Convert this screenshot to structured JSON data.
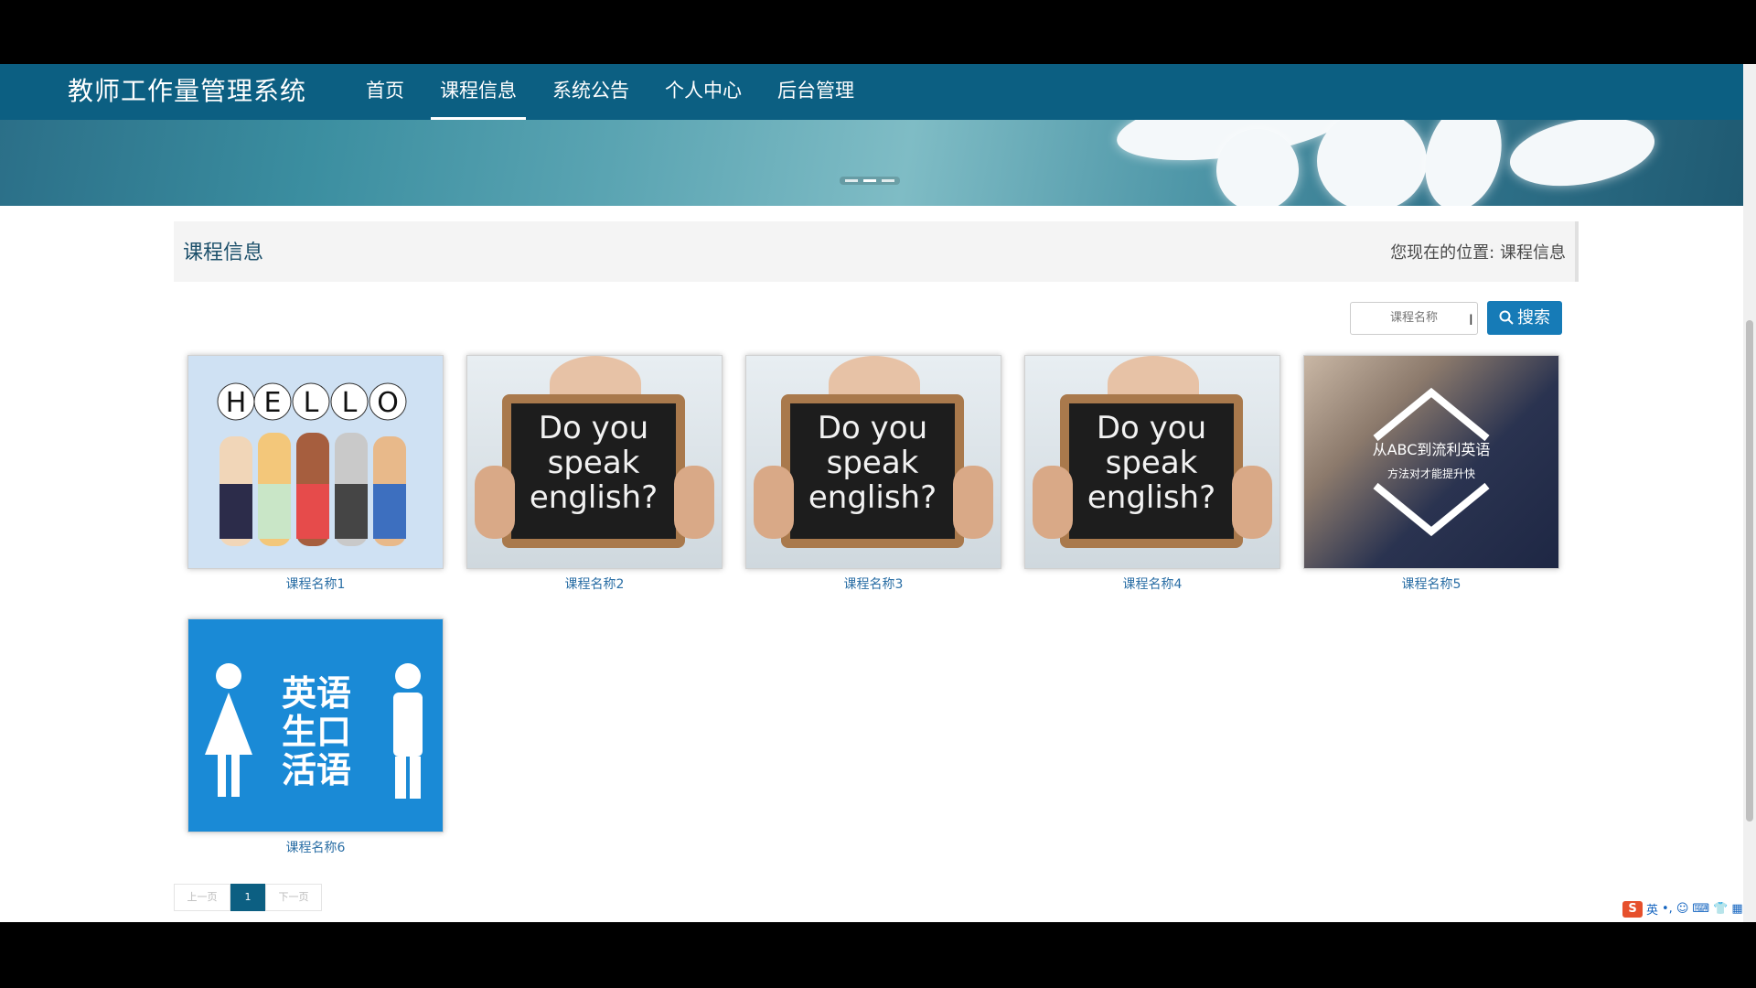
{
  "header": {
    "brand": "教师工作量管理系统",
    "nav": [
      {
        "label": "首页",
        "active": false
      },
      {
        "label": "课程信息",
        "active": true
      },
      {
        "label": "系统公告",
        "active": false
      },
      {
        "label": "个人中心",
        "active": false
      },
      {
        "label": "后台管理",
        "active": false
      }
    ]
  },
  "banner": {
    "slide_count": 3,
    "active_slide": 2
  },
  "page": {
    "title": "课程信息",
    "location_prefix": "您现在的位置:",
    "location_current": "课程信息"
  },
  "search": {
    "placeholder": "课程名称",
    "button_label": "搜索"
  },
  "courses": [
    {
      "name": "课程名称1",
      "image": "hello-cartoon"
    },
    {
      "name": "课程名称2",
      "image": "do-you-speak-english"
    },
    {
      "name": "课程名称3",
      "image": "do-you-speak-english"
    },
    {
      "name": "课程名称4",
      "image": "do-you-speak-english"
    },
    {
      "name": "课程名称5",
      "image": "abc-to-fluent-english"
    },
    {
      "name": "课程名称6",
      "image": "english-daily-spoken"
    }
  ],
  "images": {
    "hello_letters": [
      "H",
      "E",
      "L",
      "L",
      "O"
    ],
    "board_text": [
      "Do you",
      "speak",
      "english?"
    ],
    "abc_title": "从ABC到流利英语",
    "abc_subtitle": "方法对才能提升快",
    "eng_lines": [
      "英语",
      "生口",
      "活语"
    ]
  },
  "pagination": {
    "prev_label": "上一页",
    "current": "1",
    "next_label": "下一页"
  },
  "tray": {
    "ime_label": "S",
    "lang": "英"
  },
  "colors": {
    "nav_bg": "#0c5f82",
    "search_button": "#167bb7",
    "caption": "#2a6ea5"
  }
}
